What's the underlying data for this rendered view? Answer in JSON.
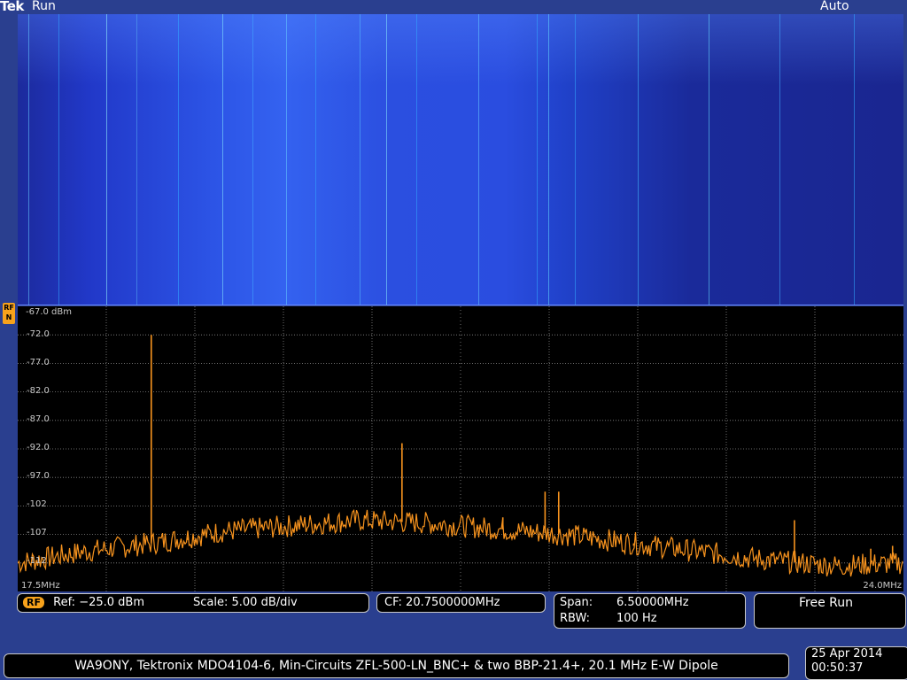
{
  "header": {
    "brand": "Tek",
    "run_state": "Run",
    "trigger_mode": "Auto"
  },
  "rf_marker": {
    "line1": "RF",
    "line2": "N"
  },
  "plot": {
    "ref_label": "-67.0 dBm",
    "y_ticks": [
      "-72.0",
      "-77.0",
      "-82.0",
      "-87.0",
      "-92.0",
      "-97.0",
      "-102",
      "-107",
      "-112"
    ],
    "x_start": "17.5MHz",
    "x_end": "24.0MHz",
    "trace_color": "#f7931e",
    "grid_color": "#8a8a8a"
  },
  "chart_data": {
    "type": "line",
    "y_range_dbm": [
      -67,
      -117
    ],
    "x_range_mhz": [
      17.5,
      24.0
    ],
    "noise_floor": [
      [
        17.5,
        -112
      ],
      [
        18.0,
        -110
      ],
      [
        18.5,
        -108.5
      ],
      [
        19.0,
        -106.5
      ],
      [
        19.5,
        -105.5
      ],
      [
        20.0,
        -104.5
      ],
      [
        20.5,
        -105
      ],
      [
        21.0,
        -106
      ],
      [
        21.5,
        -107
      ],
      [
        22.0,
        -108.5
      ],
      [
        22.5,
        -110
      ],
      [
        23.0,
        -111.5
      ],
      [
        23.5,
        -112.5
      ],
      [
        24.0,
        -112
      ]
    ],
    "peaks": [
      [
        18.48,
        -72
      ],
      [
        18.75,
        -108
      ],
      [
        19.68,
        -106
      ],
      [
        20.32,
        -91
      ],
      [
        20.88,
        -106
      ],
      [
        21.06,
        -104
      ],
      [
        21.37,
        -99.5
      ],
      [
        21.47,
        -99.5
      ],
      [
        22.02,
        -109
      ],
      [
        23.2,
        -104.5
      ],
      [
        23.76,
        -109.5
      ],
      [
        23.92,
        -109
      ]
    ]
  },
  "readouts": {
    "rf": {
      "badge": "RF",
      "ref": "Ref: −25.0 dBm",
      "scale": "Scale: 5.00 dB/div"
    },
    "cf": {
      "text": "CF:  20.7500000MHz"
    },
    "span": {
      "span_label": "Span:",
      "span_value": "6.50000MHz",
      "rbw_label": "RBW:",
      "rbw_value": "100 Hz"
    },
    "run": {
      "text": "Free Run"
    }
  },
  "footer": {
    "caption": "WA9ONY, Tektronix MDO4104-6, Min-Circuits ZFL-500-LN_BNC+ & two BBP-21.4+, 20.1 MHz E-W Dipole"
  },
  "datetime": {
    "date": "25 Apr 2014",
    "time": "00:50:37"
  }
}
